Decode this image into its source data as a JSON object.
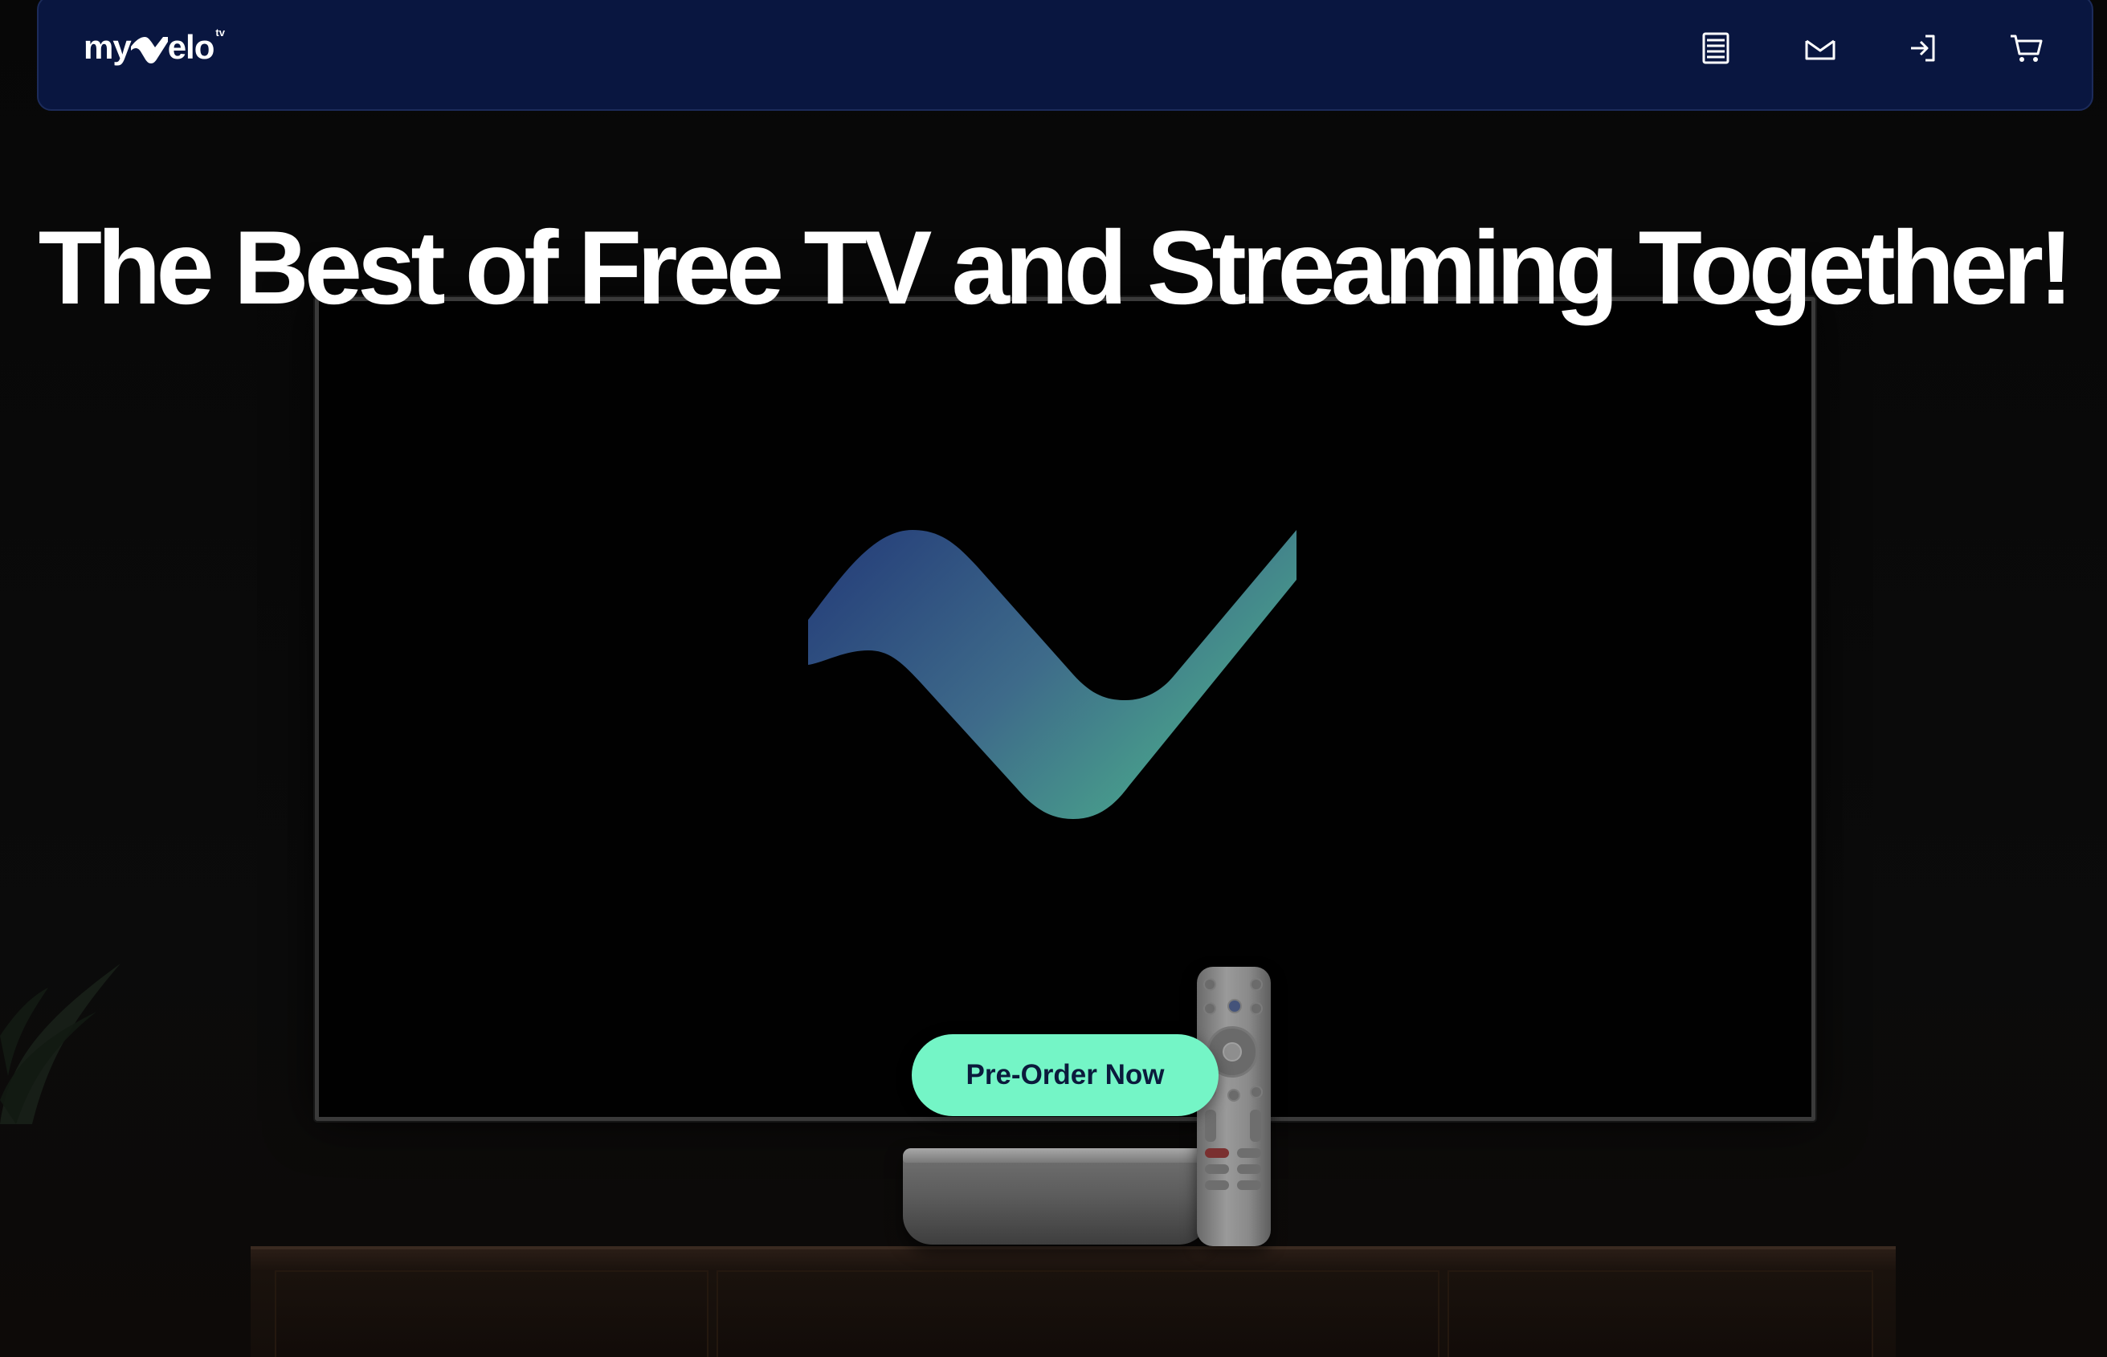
{
  "brand": {
    "prefix": "my",
    "suffix": "elo",
    "superscript": "tv",
    "logo_icon": "velo-v-logo-icon"
  },
  "nav": {
    "icons": [
      {
        "name": "menu-list-icon"
      },
      {
        "name": "mail-icon"
      },
      {
        "name": "sign-in-icon"
      },
      {
        "name": "cart-icon"
      }
    ]
  },
  "hero": {
    "title": "The Best of Free TV and Streaming Together!",
    "cta_label": "Pre-Order Now"
  },
  "colors": {
    "navbar_bg": "#091640",
    "cta_bg": "#74f5c6",
    "cta_text": "#0b1a3c",
    "logo_gradient_start": "#233a78",
    "logo_gradient_end": "#4aa88c"
  }
}
